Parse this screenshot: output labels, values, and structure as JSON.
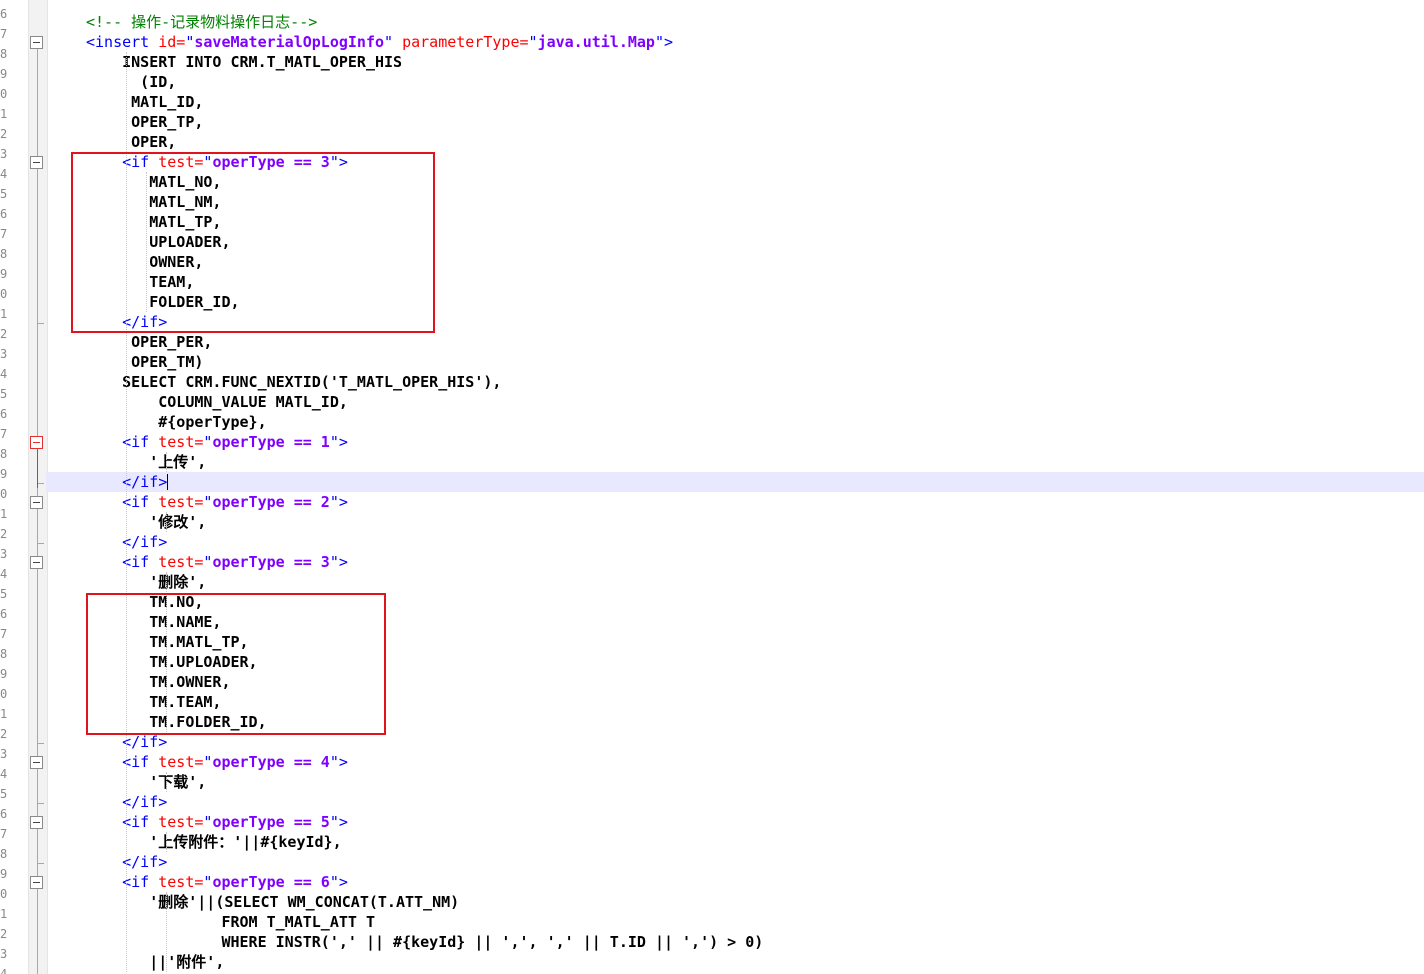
{
  "gutter": {
    "line_number_digits": [
      "6",
      "7",
      "8",
      "9",
      "0",
      "1",
      "2",
      "3",
      "4",
      "5",
      "6",
      "7",
      "8",
      "9",
      "0",
      "1",
      "2",
      "3",
      "4",
      "5",
      "6",
      "7",
      "8",
      "9",
      "0",
      "1",
      "2",
      "3",
      "4",
      "5",
      "6",
      "7",
      "8",
      "9",
      "0",
      "1",
      "2",
      "3",
      "4",
      "5",
      "6",
      "7",
      "8",
      "9",
      "0",
      "1",
      "2",
      "3",
      "4"
    ]
  },
  "colors": {
    "comment": "#008000",
    "tag": "#0000ff",
    "attribute": "#ff0000",
    "attribute_value": "#8000ff",
    "sql": "#000000",
    "current_line_bg": "#e8e8ff",
    "annotation_box": "#e0141e"
  },
  "icons": [
    "fold-minus-icon",
    "fold-end-icon",
    "text-caret-icon"
  ],
  "editor": {
    "current_line": 23,
    "lines": [
      [
        [
          "c",
          "<!-- 操作-记录物料操作日志-->"
        ]
      ],
      [
        [
          "t",
          "<insert "
        ],
        [
          "a",
          "id="
        ],
        [
          "t",
          "\""
        ],
        [
          "v",
          "saveMaterialOpLogInfo"
        ],
        [
          "t",
          "\" "
        ],
        [
          "a",
          "parameterType="
        ],
        [
          "t",
          "\""
        ],
        [
          "v",
          "java.util.Map"
        ],
        [
          "t",
          "\">"
        ]
      ],
      [
        [
          "s",
          "    INSERT INTO CRM.T_MATL_OPER_HIS"
        ]
      ],
      [
        [
          "s",
          "      (ID,"
        ]
      ],
      [
        [
          "s",
          "     MATL_ID,"
        ]
      ],
      [
        [
          "s",
          "     OPER_TP,"
        ]
      ],
      [
        [
          "s",
          "     OPER,"
        ]
      ],
      [
        [
          "t",
          "    <if "
        ],
        [
          "a",
          "test="
        ],
        [
          "t",
          "\""
        ],
        [
          "v",
          "operType == 3"
        ],
        [
          "t",
          "\">"
        ]
      ],
      [
        [
          "s",
          "       MATL_NO,"
        ]
      ],
      [
        [
          "s",
          "       MATL_NM,"
        ]
      ],
      [
        [
          "s",
          "       MATL_TP,"
        ]
      ],
      [
        [
          "s",
          "       UPLOADER,"
        ]
      ],
      [
        [
          "s",
          "       OWNER,"
        ]
      ],
      [
        [
          "s",
          "       TEAM,"
        ]
      ],
      [
        [
          "s",
          "       FOLDER_ID,"
        ]
      ],
      [
        [
          "t",
          "    </if>"
        ]
      ],
      [
        [
          "s",
          "     OPER_PER,"
        ]
      ],
      [
        [
          "s",
          "     OPER_TM)"
        ]
      ],
      [
        [
          "s",
          "    SELECT CRM.FUNC_NEXTID('T_MATL_OPER_HIS'),"
        ]
      ],
      [
        [
          "s",
          "        COLUMN_VALUE MATL_ID,"
        ]
      ],
      [
        [
          "s",
          "        #{operType},"
        ]
      ],
      [
        [
          "t",
          "    <if "
        ],
        [
          "a",
          "test="
        ],
        [
          "t",
          "\""
        ],
        [
          "v",
          "operType == 1"
        ],
        [
          "t",
          "\">"
        ]
      ],
      [
        [
          "s",
          "       '上传',"
        ]
      ],
      [
        [
          "t",
          "    </if>"
        ]
      ],
      [
        [
          "t",
          "    <if "
        ],
        [
          "a",
          "test="
        ],
        [
          "t",
          "\""
        ],
        [
          "v",
          "operType == 2"
        ],
        [
          "t",
          "\">"
        ]
      ],
      [
        [
          "s",
          "       '修改',"
        ]
      ],
      [
        [
          "t",
          "    </if>"
        ]
      ],
      [
        [
          "t",
          "    <if "
        ],
        [
          "a",
          "test="
        ],
        [
          "t",
          "\""
        ],
        [
          "v",
          "operType == 3"
        ],
        [
          "t",
          "\">"
        ]
      ],
      [
        [
          "s",
          "       '删除',"
        ]
      ],
      [
        [
          "s",
          "       TM.NO,"
        ]
      ],
      [
        [
          "s",
          "       TM.NAME,"
        ]
      ],
      [
        [
          "s",
          "       TM.MATL_TP,"
        ]
      ],
      [
        [
          "s",
          "       TM.UPLOADER,"
        ]
      ],
      [
        [
          "s",
          "       TM.OWNER,"
        ]
      ],
      [
        [
          "s",
          "       TM.TEAM,"
        ]
      ],
      [
        [
          "s",
          "       TM.FOLDER_ID,"
        ]
      ],
      [
        [
          "t",
          "    </if>"
        ]
      ],
      [
        [
          "t",
          "    <if "
        ],
        [
          "a",
          "test="
        ],
        [
          "t",
          "\""
        ],
        [
          "v",
          "operType == 4"
        ],
        [
          "t",
          "\">"
        ]
      ],
      [
        [
          "s",
          "       '下载',"
        ]
      ],
      [
        [
          "t",
          "    </if>"
        ]
      ],
      [
        [
          "t",
          "    <if "
        ],
        [
          "a",
          "test="
        ],
        [
          "t",
          "\""
        ],
        [
          "v",
          "operType == 5"
        ],
        [
          "t",
          "\">"
        ]
      ],
      [
        [
          "s",
          "       '上传附件：'||#{keyId},"
        ]
      ],
      [
        [
          "t",
          "    </if>"
        ]
      ],
      [
        [
          "t",
          "    <if "
        ],
        [
          "a",
          "test="
        ],
        [
          "t",
          "\""
        ],
        [
          "v",
          "operType == 6"
        ],
        [
          "t",
          "\">"
        ]
      ],
      [
        [
          "s",
          "       '删除'||(SELECT WM_CONCAT(T.ATT_NM)"
        ]
      ],
      [
        [
          "s",
          "               FROM T_MATL_ATT T"
        ]
      ],
      [
        [
          "s",
          "               WHERE INSTR(',' || #{keyId} || ',', ',' || T.ID || ',') > 0)"
        ]
      ],
      [
        [
          "s",
          "       ||'附件',"
        ]
      ]
    ]
  }
}
